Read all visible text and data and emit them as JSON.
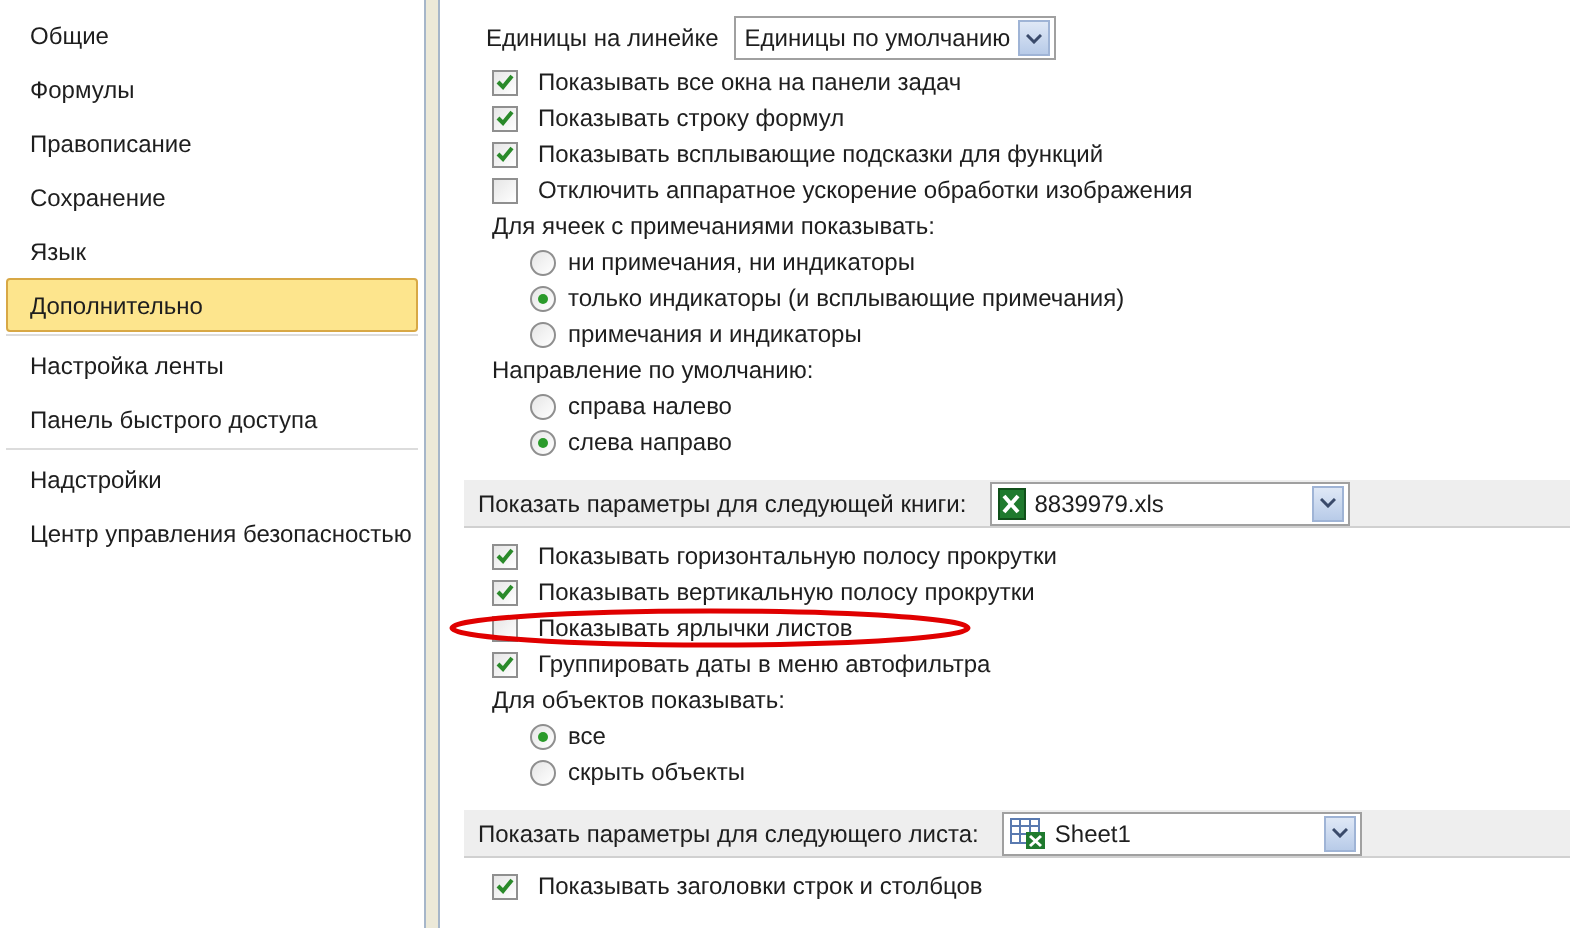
{
  "sidebar": {
    "groups": [
      [
        {
          "label": "Общие",
          "selected": false
        },
        {
          "label": "Формулы",
          "selected": false
        },
        {
          "label": "Правописание",
          "selected": false
        },
        {
          "label": "Сохранение",
          "selected": false
        },
        {
          "label": "Язык",
          "selected": false
        },
        {
          "label": "Дополнительно",
          "selected": true
        }
      ],
      [
        {
          "label": "Настройка ленты",
          "selected": false
        },
        {
          "label": "Панель быстрого доступа",
          "selected": false
        }
      ],
      [
        {
          "label": "Надстройки",
          "selected": false
        },
        {
          "label": "Центр управления безопасностью",
          "selected": false
        }
      ]
    ]
  },
  "ruler": {
    "label": "Единицы на линейке",
    "value": "Единицы по умолчанию"
  },
  "display_items": [
    {
      "kind": "checkbox",
      "label": "Показывать все окна на панели задач",
      "checked": true
    },
    {
      "kind": "checkbox",
      "label": "Показывать строку формул",
      "checked": true
    },
    {
      "kind": "checkbox",
      "label": "Показывать всплывающие подсказки для функций",
      "checked": true
    },
    {
      "kind": "checkbox",
      "label": "Отключить аппаратное ускорение обработки изображения",
      "checked": false
    },
    {
      "kind": "label",
      "label": "Для ячеек с примечаниями показывать:"
    },
    {
      "kind": "radio",
      "label": "ни примечания, ни индикаторы",
      "selected": false
    },
    {
      "kind": "radio",
      "label": "только индикаторы (и всплывающие примечания)",
      "selected": true
    },
    {
      "kind": "radio",
      "label": "примечания и индикаторы",
      "selected": false
    },
    {
      "kind": "label",
      "label": "Направление по умолчанию:"
    },
    {
      "kind": "radio",
      "label": "справа налево",
      "selected": false
    },
    {
      "kind": "radio",
      "label": "слева направо",
      "selected": true
    }
  ],
  "sections": [
    {
      "header": "Показать параметры для следующей книги:",
      "value": "8839979.xls",
      "items": [
        {
          "kind": "checkbox",
          "label": "Показывать горизонтальную полосу прокрутки",
          "checked": true
        },
        {
          "kind": "checkbox",
          "label": "Показывать вертикальную полосу прокрутки",
          "checked": true
        },
        {
          "kind": "checkbox",
          "label": "Показывать ярлычки листов",
          "checked": false
        },
        {
          "kind": "checkbox",
          "label": "Группировать даты в меню автофильтра",
          "checked": true
        },
        {
          "kind": "label",
          "label": "Для объектов показывать:"
        },
        {
          "kind": "radio",
          "label": "все",
          "selected": true
        },
        {
          "kind": "radio",
          "label": "скрыть объекты",
          "selected": false
        }
      ]
    },
    {
      "header": "Показать параметры для следующего листа:",
      "value": "Sheet1",
      "items": [
        {
          "kind": "checkbox",
          "label": "Показывать заголовки строк и столбцов",
          "checked": true
        }
      ]
    }
  ]
}
